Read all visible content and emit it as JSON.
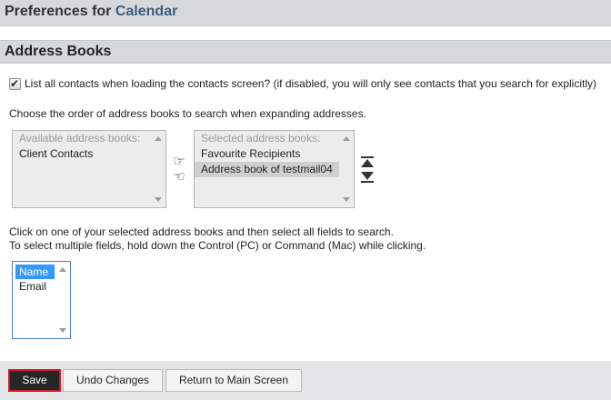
{
  "header": {
    "title_prefix": "Preferences for",
    "app_name": "Calendar"
  },
  "section": {
    "title": "Address Books"
  },
  "list_all_contacts": {
    "checked": true,
    "label": "List all contacts when loading the contacts screen? (if disabled, you will only see contacts that you search for explicitly)"
  },
  "order_instructions": "Choose the order of address books to search when expanding addresses.",
  "available_books": {
    "header": "Available address books:",
    "items": [
      "Client Contacts"
    ]
  },
  "selected_books": {
    "header": "Selected address books:",
    "items": [
      "Favourite Recipients",
      "Address book of testmail04"
    ],
    "highlighted": "Address book of testmail04"
  },
  "arrow_icons": {
    "add": "hand-right-icon",
    "remove": "hand-left-icon",
    "move_top": "move-to-top-icon",
    "move_bottom": "move-to-bottom-icon"
  },
  "field_instructions": {
    "line1": "Click on one of your selected address books and then select all fields to search.",
    "line2": "To select multiple fields, hold down the Control (PC) or Command (Mac) while clicking."
  },
  "fields": {
    "items": [
      "Name",
      "Email"
    ],
    "selected": "Name"
  },
  "footer": {
    "save_label": "Save",
    "undo_label": "Undo Changes",
    "return_label": "Return to Main Screen"
  },
  "colors": {
    "header_bg": "#d6d9dc",
    "app_name": "#3b5f7c",
    "selection": "#3399ff",
    "save_bg": "#262626",
    "save_border": "#d11a2a"
  }
}
